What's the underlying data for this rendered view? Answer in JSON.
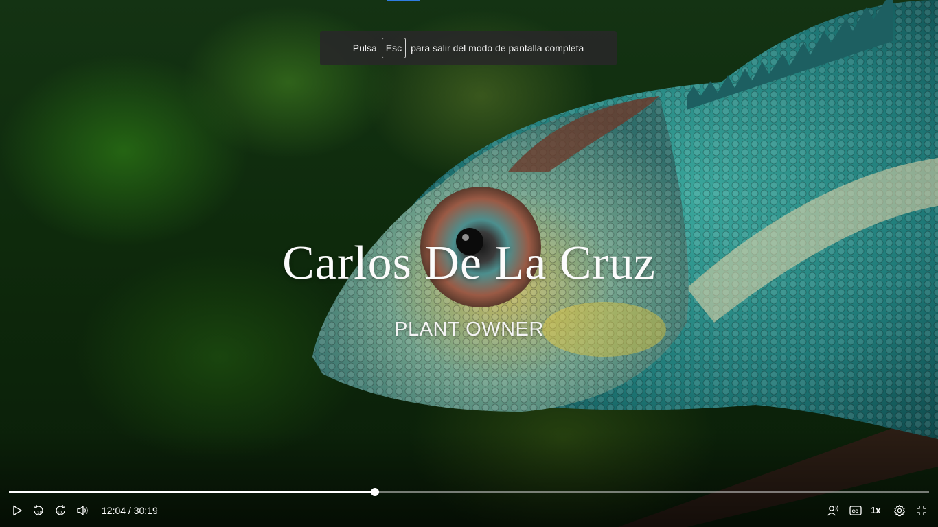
{
  "toast": {
    "prefix": "Pulsa",
    "key": "Esc",
    "suffix": "para salir del modo de pantalla completa"
  },
  "video": {
    "title": "Carlos De La Cruz",
    "subtitle": "PLANT OWNER"
  },
  "player": {
    "time": "12:04 / 30:19",
    "progress_fraction": 0.398,
    "playback_rate": "1x",
    "accent_color": "#2f7de1",
    "icons": [
      "play-icon",
      "rewind-10-icon",
      "forward-10-icon",
      "volume-icon",
      "voice-icon",
      "captions-icon",
      "settings-icon",
      "exit-fullscreen-icon"
    ]
  }
}
